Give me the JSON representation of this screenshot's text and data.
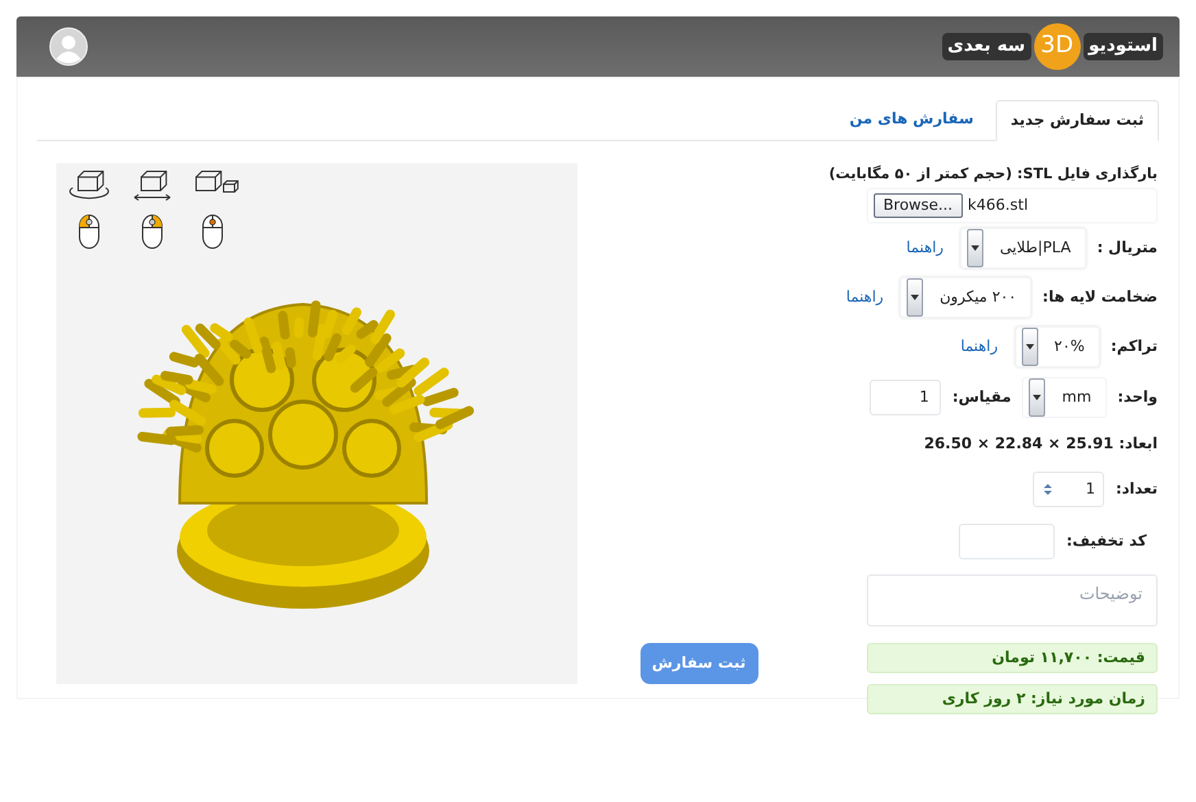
{
  "header": {
    "logo": {
      "word_1": "استودیو",
      "badge": "3D",
      "word_2": "سه بعدی"
    }
  },
  "tabs": [
    {
      "label": "ثبت سفارش جدید",
      "selected": true
    },
    {
      "label": "سفارش های من",
      "selected": false
    }
  ],
  "upload": {
    "label": "بارگذاری فایل STL: (حجم کمتر از ۵۰ مگابایت)",
    "browse_button": "Browse...",
    "file_name": "k466.stl"
  },
  "fields": [
    {
      "kind": "select",
      "label": "متریال :",
      "value": "PLA|طلایی",
      "help": "راهنما"
    },
    {
      "kind": "select",
      "label": "ضخامت لایه ها:",
      "value": "۲۰۰ میکرون",
      "help": "راهنما"
    },
    {
      "kind": "select",
      "label": "تراکم:",
      "value": "۲۰%",
      "help": "راهنما"
    },
    {
      "kind": "unit",
      "label": "واحد:",
      "value": "mm",
      "scale_label": "مقیاس:",
      "scale_value": "1"
    },
    {
      "kind": "info",
      "label": "ابعاد: 25.91 × 22.84 × 26.50"
    },
    {
      "kind": "number",
      "label": "تعداد:",
      "value": "1"
    },
    {
      "kind": "text",
      "label": "کد تخفیف:"
    },
    {
      "kind": "textarea",
      "placeholder": "توضیحات"
    }
  ],
  "alerts": [
    "قیمت: ۱۱,۷۰۰ تومان",
    "زمان مورد نیاز: ۲ روز کاری"
  ],
  "submit_button": "ثبت سفارش"
}
